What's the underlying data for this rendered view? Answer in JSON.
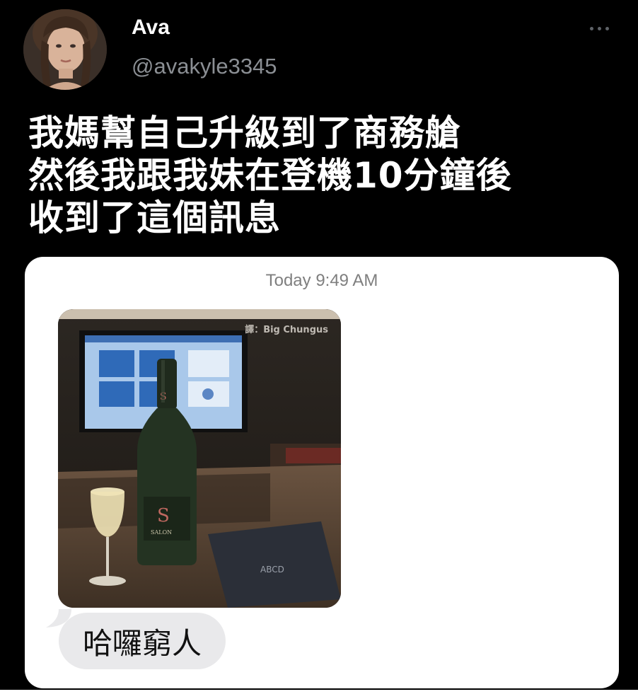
{
  "tweet": {
    "author_name": "Ava",
    "author_handle": "@avakyle3345",
    "text_lines": [
      "我媽幫自己升級到了商務艙",
      "然後我跟我妹在登機10分鐘後",
      "收到了這個訊息"
    ]
  },
  "message": {
    "timestamp": "Today 9:49 AM",
    "image_credit": "譯：Big Chungus",
    "bubble_text": "哈囉窮人"
  },
  "colors": {
    "tweet_bg": "#000000",
    "handle": "#8b8f94",
    "bubble_bg": "#e9e9eb",
    "timestamp": "#7f7f7f"
  },
  "icons": [
    "more-options-icon"
  ]
}
